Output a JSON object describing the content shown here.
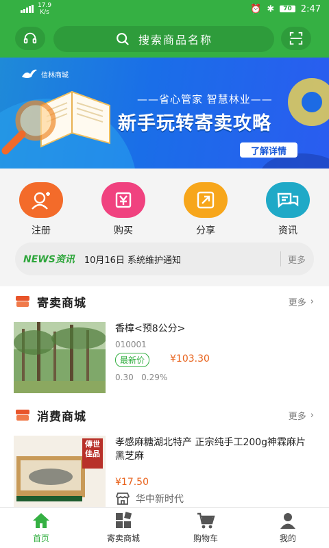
{
  "status_bar": {
    "network": "4G",
    "speed": "17.9",
    "speed_unit": "K/s",
    "battery": "70",
    "time": "2:47"
  },
  "header": {
    "search_placeholder": "搜索商品名称",
    "support_icon": "headset-icon",
    "scan_icon": "scan-icon"
  },
  "banner": {
    "logo_text": "信林商城",
    "subtitle": "——省心管家 智慧林业——",
    "title": "新手玩转寄卖攻略",
    "button": "了解详情"
  },
  "quick_menu": [
    {
      "label": "注册",
      "icon": "user-add-icon",
      "color": "#f36b2a"
    },
    {
      "label": "购买",
      "icon": "purchase-icon",
      "color": "#f0427f"
    },
    {
      "label": "分享",
      "icon": "share-icon",
      "color": "#f7a61b"
    },
    {
      "label": "资讯",
      "icon": "news-icon",
      "color": "#1fa9c7"
    }
  ],
  "news": {
    "logo_prefix": "NEWS",
    "logo_suffix": "资讯",
    "text": "10月16日 系统维护通知",
    "more": "更多"
  },
  "consign_section": {
    "title": "寄卖商城",
    "more": "更多",
    "product": {
      "name": "香樟<预8公分>",
      "code": "010001",
      "tag": "最新价",
      "price": "¥103.30",
      "stat1": "0.30",
      "stat2": "0.29%"
    }
  },
  "consumer_section": {
    "title": "消费商城",
    "more": "更多",
    "product": {
      "name": "孝感麻糖湖北特产 正宗纯手工200g神霖麻片黑芝麻",
      "price": "¥17.50",
      "shop": "华中新时代",
      "image_badge": "傳世佳品"
    }
  },
  "tabbar": [
    {
      "label": "首页",
      "icon": "home-icon",
      "active": true
    },
    {
      "label": "寄卖商城",
      "icon": "grid-icon",
      "active": false
    },
    {
      "label": "购物车",
      "icon": "cart-icon",
      "active": false
    },
    {
      "label": "我的",
      "icon": "user-icon",
      "active": false
    }
  ],
  "colors": {
    "primary": "#35b043",
    "price": "#e8611a"
  }
}
